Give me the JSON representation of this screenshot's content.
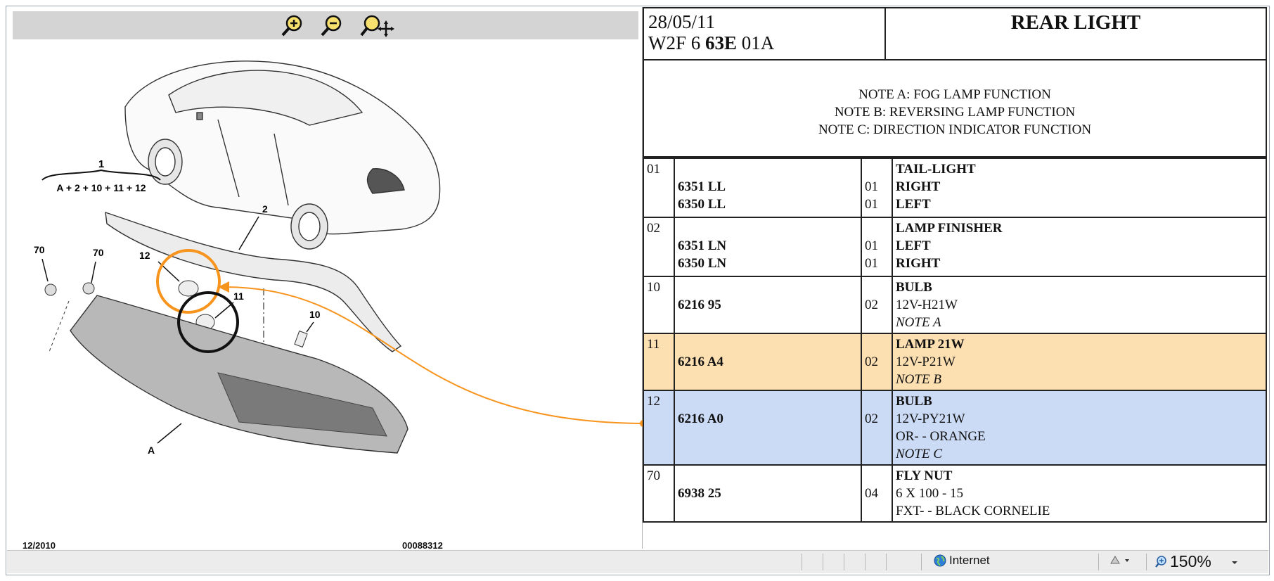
{
  "toolbar": {
    "zoom_in_icon": "magnifier-plus-icon",
    "zoom_out_icon": "magnifier-minus-icon",
    "pan_icon": "magnifier-move-icon"
  },
  "diagram": {
    "callouts": [
      "1",
      "A + 2 + 10 + 11 + 12",
      "2",
      "70",
      "70",
      "12",
      "11",
      "10",
      "A"
    ],
    "footer_date": "12/2010",
    "footer_code": "00088312",
    "highlight_colors": {
      "orange": "#f7941d",
      "black": "#111111"
    }
  },
  "header": {
    "date": "28/05/11",
    "code_prefix": "W2F 6 ",
    "code_bold": "63E",
    "code_suffix": " 01A",
    "title": "REAR LIGHT"
  },
  "notes": [
    "NOTE A: FOG LAMP FUNCTION",
    "NOTE B: REVERSING LAMP FUNCTION",
    "NOTE C: DIRECTION INDICATOR FUNCTION"
  ],
  "parts": [
    {
      "item": "01",
      "lines": [
        {
          "ref": "",
          "qty": "",
          "desc": "TAIL-LIGHT"
        },
        {
          "ref": "6351 LL",
          "qty": "01",
          "desc": "RIGHT"
        },
        {
          "ref": "6350 LL",
          "qty": "01",
          "desc": "LEFT"
        }
      ]
    },
    {
      "item": "02",
      "lines": [
        {
          "ref": "",
          "qty": "",
          "desc": "LAMP FINISHER"
        },
        {
          "ref": "6351 LN",
          "qty": "01",
          "desc": "LEFT"
        },
        {
          "ref": "6350 LN",
          "qty": "01",
          "desc": "RIGHT"
        }
      ]
    },
    {
      "item": "10",
      "ref": "6216 95",
      "qty": "02",
      "desc": [
        "BULB",
        "12V-H21W",
        "NOTE A"
      ]
    },
    {
      "item": "11",
      "ref": "6216 A4",
      "qty": "02",
      "desc": [
        "LAMP 21W",
        "12V-P21W",
        "NOTE B"
      ]
    },
    {
      "item": "12",
      "ref": "6216 A0",
      "qty": "02",
      "desc": [
        "BULB",
        "12V-PY21W",
        "OR- - ORANGE",
        "NOTE C"
      ]
    },
    {
      "item": "70",
      "ref": "6938 25",
      "qty": "04",
      "desc": [
        "FLY NUT",
        "6 X 100 - 15",
        "FXT- - BLACK CORNELIE"
      ]
    }
  ],
  "status": {
    "zone_icon": "globe-icon",
    "zone": "Internet",
    "secure_icon": "security-icon",
    "zoom_icon": "zoom-magnifier-icon",
    "zoom": "150%",
    "dropdown_icon": "chevron-down-icon"
  }
}
